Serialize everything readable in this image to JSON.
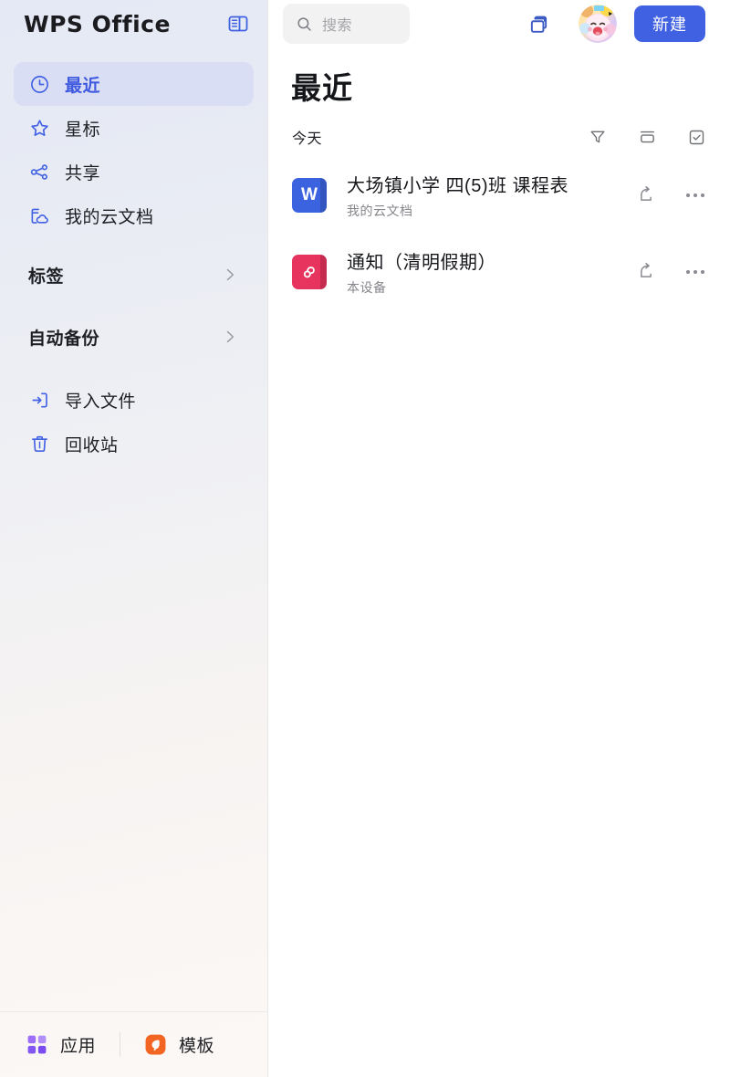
{
  "app": {
    "brand": "WPS Office",
    "accent": "#4161e3",
    "sidebar_icon_color": "#4161e3"
  },
  "sidebar": {
    "panel_toggle_icon": "panel-toggle-icon",
    "nav_top": [
      {
        "label": "最近",
        "icon": "clock-icon",
        "active": true
      },
      {
        "label": "星标",
        "icon": "star-icon",
        "active": false
      },
      {
        "label": "共享",
        "icon": "share-nodes-icon",
        "active": false
      },
      {
        "label": "我的云文档",
        "icon": "cloud-folder-icon",
        "active": false
      }
    ],
    "groups": [
      {
        "label": "标签",
        "icon": "chevron-right-icon"
      },
      {
        "label": "自动备份",
        "icon": "chevron-right-icon"
      }
    ],
    "nav_bottom": [
      {
        "label": "导入文件",
        "icon": "import-file-icon"
      },
      {
        "label": "回收站",
        "icon": "trash-icon"
      }
    ],
    "footer": [
      {
        "label": "应用",
        "icon": "apps-grid-icon",
        "color": "#8a5cf6"
      },
      {
        "label": "模板",
        "icon": "template-leaf-icon",
        "color": "#f26522"
      }
    ]
  },
  "topbar": {
    "search": {
      "placeholder": "搜索",
      "value": "",
      "icon": "search-icon"
    },
    "window_icon": "multi-window-icon",
    "avatar": "user-avatar",
    "new_button": "新建"
  },
  "main": {
    "title": "最近",
    "section": {
      "label": "今天",
      "icons": [
        {
          "name": "filter-icon"
        },
        {
          "name": "sort-icon"
        },
        {
          "name": "select-checkbox-icon"
        }
      ]
    },
    "files": [
      {
        "name": "大场镇小学 四(5)班 课程表",
        "location": "我的云文档",
        "type": "W",
        "color": "#3b63e0",
        "share_icon": "share-icon",
        "more_icon": "more-icon"
      },
      {
        "name": "通知（清明假期）",
        "location": "本设备",
        "type": "P",
        "color": "#e6345e",
        "share_icon": "share-icon",
        "more_icon": "more-icon"
      }
    ]
  }
}
